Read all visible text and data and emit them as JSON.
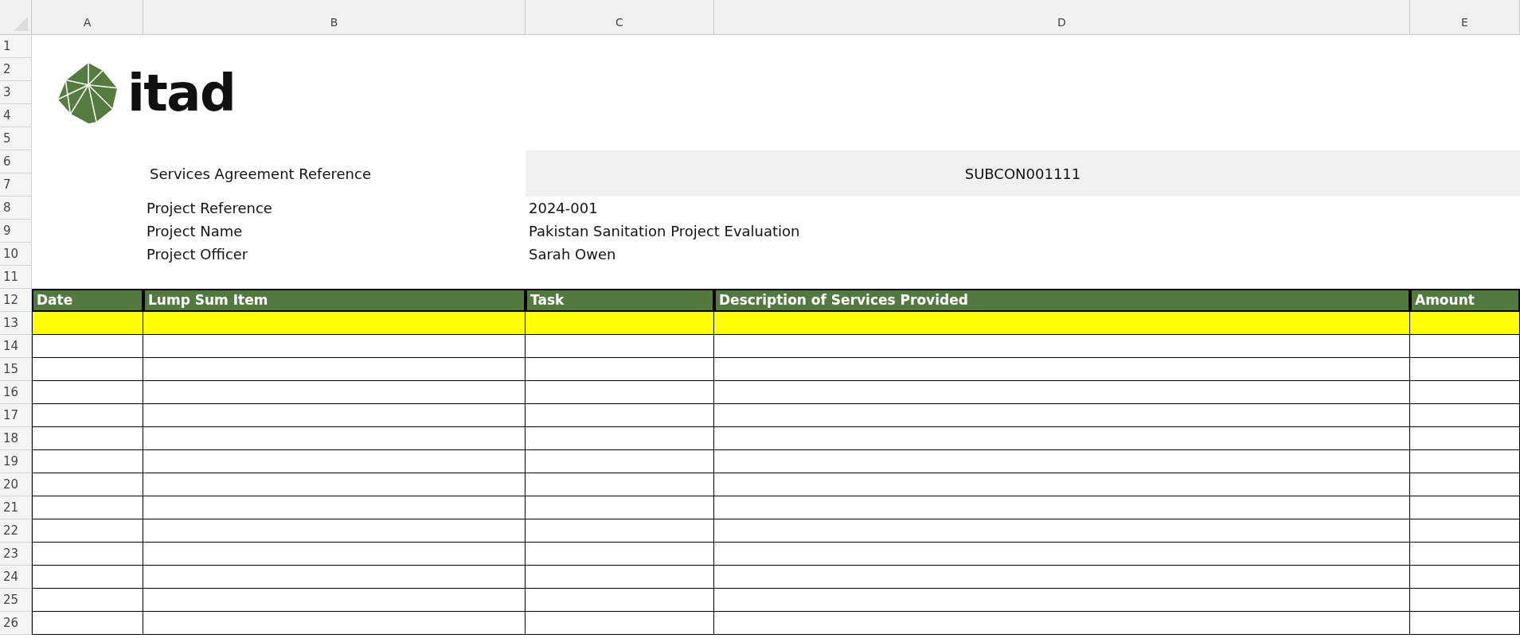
{
  "column_headers": [
    "A",
    "B",
    "C",
    "D",
    "E"
  ],
  "row_numbers": [
    "1",
    "2",
    "3",
    "4",
    "5",
    "6",
    "7",
    "8",
    "9",
    "10",
    "11",
    "12",
    "13",
    "14",
    "15",
    "16",
    "17",
    "18",
    "19",
    "20",
    "21",
    "22",
    "23",
    "24",
    "25",
    "26"
  ],
  "logo": {
    "wordmark": "itad"
  },
  "agreement": {
    "label": "Services Agreement Reference",
    "value": "SUBCON001111"
  },
  "details": [
    {
      "label": "Project Reference",
      "value": "2024-001"
    },
    {
      "label": "Project Name",
      "value": "Pakistan Sanitation Project Evaluation"
    },
    {
      "label": "Project Officer",
      "value": "Sarah Owen"
    }
  ],
  "table": {
    "columns": [
      "Date",
      "Lump Sum Item",
      "Task",
      "Description of Services Provided",
      "Amount"
    ],
    "rows": [
      {
        "highlighted": true
      },
      {
        "highlighted": false
      },
      {
        "highlighted": false
      },
      {
        "highlighted": false
      },
      {
        "highlighted": false
      },
      {
        "highlighted": false
      },
      {
        "highlighted": false
      },
      {
        "highlighted": false
      },
      {
        "highlighted": false
      },
      {
        "highlighted": false
      },
      {
        "highlighted": false
      },
      {
        "highlighted": false
      },
      {
        "highlighted": false
      },
      {
        "highlighted": false
      }
    ]
  }
}
